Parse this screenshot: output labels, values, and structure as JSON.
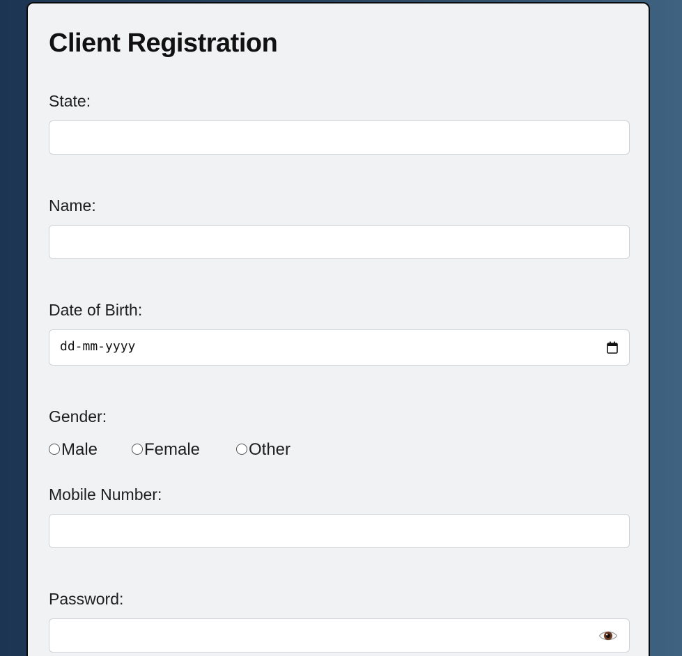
{
  "form": {
    "title": "Client Registration",
    "fields": {
      "state": {
        "label": "State:",
        "value": "",
        "placeholder": ""
      },
      "name": {
        "label": "Name:",
        "value": "",
        "placeholder": ""
      },
      "dob": {
        "label": "Date of Birth:",
        "placeholder": "dd-mm-yyyy"
      },
      "gender": {
        "label": "Gender:",
        "options": [
          "Male",
          "Female",
          "Other"
        ]
      },
      "mobile": {
        "label": "Mobile Number:",
        "value": "",
        "placeholder": ""
      },
      "password": {
        "label": "Password:",
        "value": "",
        "placeholder": ""
      }
    }
  },
  "icons": {
    "calendar": "calendar-icon",
    "password_toggle": "eye-icon"
  },
  "colors": {
    "background_left": "#1c3553",
    "background_right": "#3e6280",
    "card": "#f1f2f4",
    "card_border": "#0b0b0b",
    "input_border": "#cfd2d6"
  }
}
